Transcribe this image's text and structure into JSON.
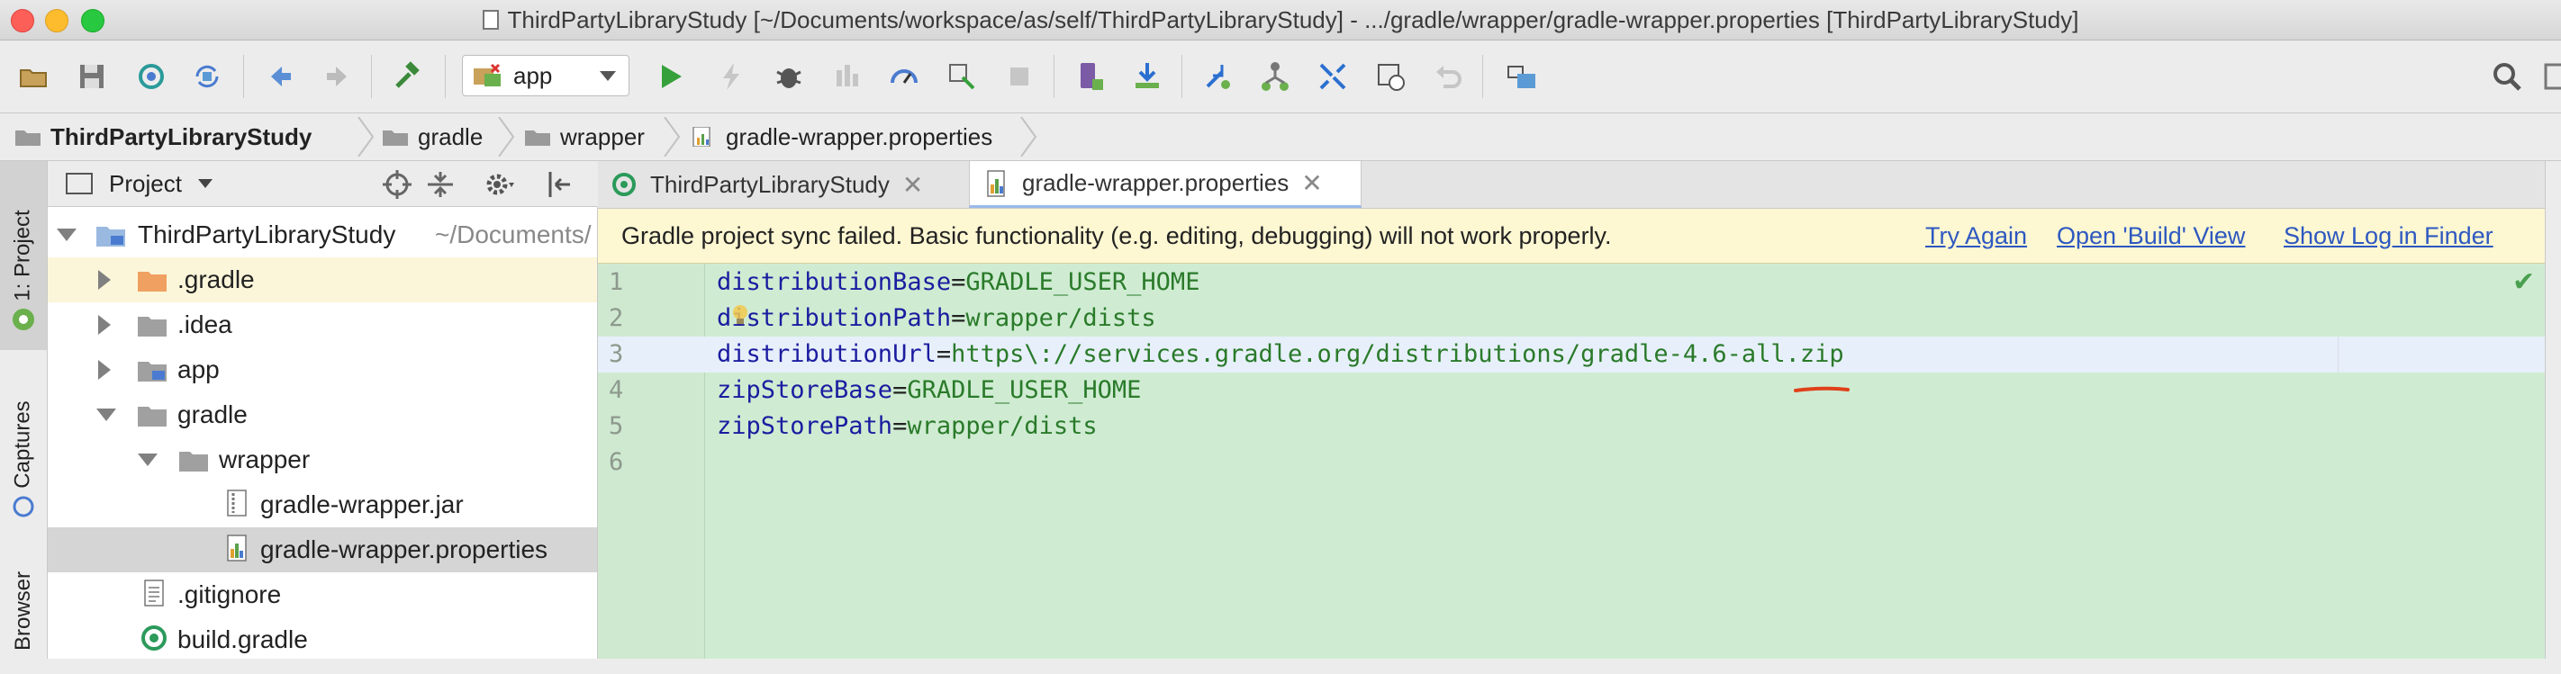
{
  "window": {
    "title": "ThirdPartyLibraryStudy [~/Documents/workspace/as/self/ThirdPartyLibraryStudy] - .../gradle/wrapper/gradle-wrapper.properties [ThirdPartyLibraryStudy]"
  },
  "toolbar": {
    "run_config": "app",
    "icons": [
      "open-icon",
      "save-icon",
      "sync-icon",
      "refresh-icon",
      "back-icon",
      "forward-icon",
      "build-icon",
      "run-icon",
      "apply-changes-icon",
      "debug-icon",
      "attach-debugger-icon",
      "profile-icon",
      "layout-inspector-icon",
      "stop-icon",
      "avd-manager-icon",
      "sdk-manager-icon",
      "gradle-sync-icon",
      "structure-icon",
      "capture-icon",
      "undo-icon",
      "project-structure-icon",
      "search-icon"
    ]
  },
  "breadcrumbs": [
    "ThirdPartyLibraryStudy",
    "gradle",
    "wrapper",
    "gradle-wrapper.properties"
  ],
  "left_strip": {
    "tabs": [
      "1: Project",
      "Captures",
      "Browser"
    ]
  },
  "project_panel": {
    "title": "Project",
    "tree": [
      {
        "label": "ThirdPartyLibraryStudy",
        "extra": "~/Documents/"
      },
      {
        "label": ".gradle"
      },
      {
        "label": ".idea"
      },
      {
        "label": "app"
      },
      {
        "label": "gradle"
      },
      {
        "label": "wrapper"
      },
      {
        "label": "gradle-wrapper.jar"
      },
      {
        "label": "gradle-wrapper.properties"
      },
      {
        "label": ".gitignore"
      },
      {
        "label": "build.gradle"
      }
    ]
  },
  "tabs": [
    "ThirdPartyLibraryStudy",
    "gradle-wrapper.properties"
  ],
  "banner": {
    "message": "Gradle project sync failed. Basic functionality (e.g. editing, debugging) will not work properly.",
    "links": [
      "Try Again",
      "Open 'Build' View",
      "Show Log in Finder"
    ]
  },
  "editor": {
    "line_numbers": [
      "1",
      "2",
      "3",
      "4",
      "5",
      "6"
    ],
    "lines": [
      {
        "key": "distributionBase",
        "eq": "=",
        "value": "GRADLE_USER_HOME"
      },
      {
        "key": "distributionPath",
        "eq": "=",
        "value": "wrapper/dists"
      },
      {
        "key": "distributionUrl",
        "eq": "=",
        "value": "https\\://services.gradle.org/distributions/gradle-4.6-all.zip"
      },
      {
        "key": "zipStoreBase",
        "eq": "=",
        "value": "GRADLE_USER_HOME"
      },
      {
        "key": "zipStorePath",
        "eq": "=",
        "value": "wrapper/dists"
      },
      {
        "key": "",
        "eq": "",
        "value": ""
      }
    ],
    "current_line": 3
  },
  "colors": {
    "editor_bg": "#cfecd2",
    "banner_bg": "#fdf7d2",
    "link": "#2d58c0",
    "annotation": "#e0401a"
  }
}
